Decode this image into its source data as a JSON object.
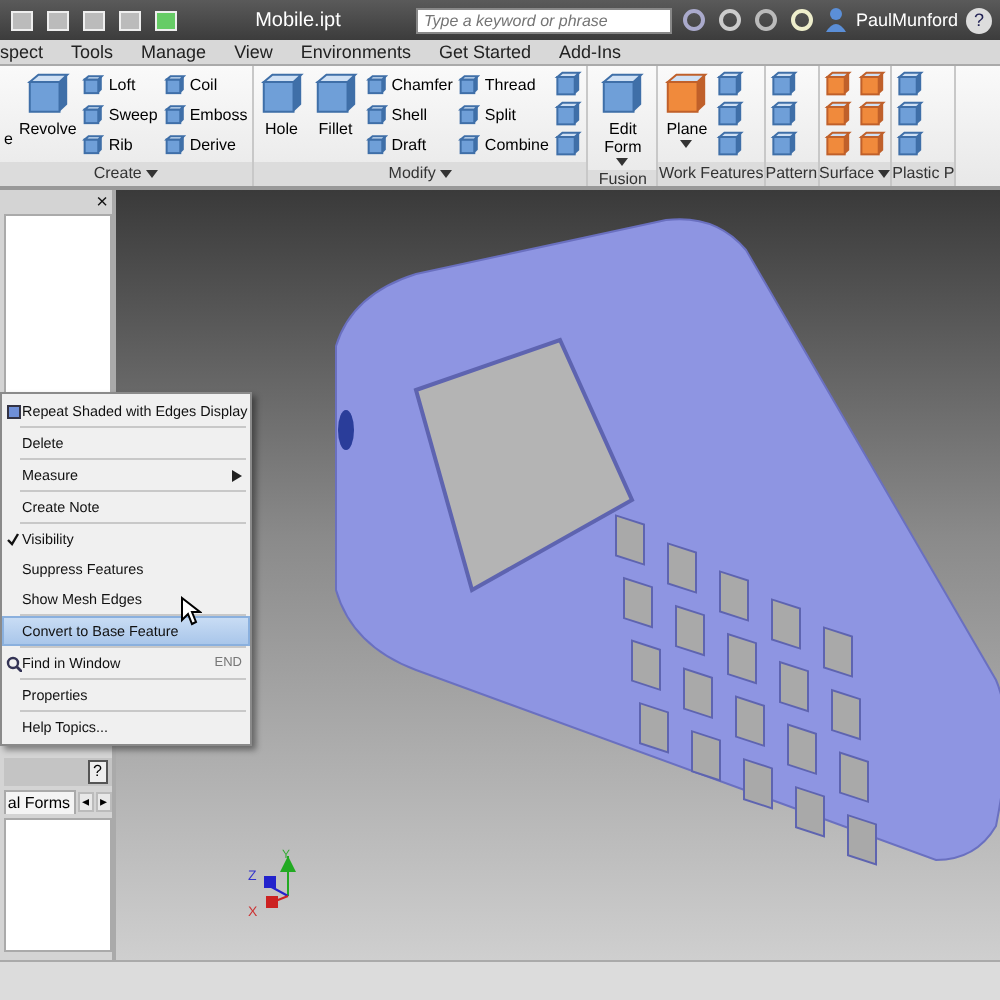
{
  "titlebar": {
    "title": "Mobile.ipt",
    "search": {
      "placeholder": "Type a keyword or phrase"
    },
    "user": "PaulMunford",
    "help": "?"
  },
  "menu_tabs": [
    "spect",
    "Tools",
    "Manage",
    "View",
    "Environments",
    "Get Started",
    "Add-Ins"
  ],
  "ribbon": [
    {
      "title": "Create",
      "dropdown": true,
      "columns": [
        [
          {
            "kind": "cut",
            "label": "e"
          }
        ],
        [
          {
            "kind": "large",
            "label": "Revolve",
            "dropdown": false
          }
        ],
        [
          {
            "kind": "small",
            "label": "Loft"
          },
          {
            "kind": "small",
            "label": "Sweep"
          },
          {
            "kind": "small",
            "label": "Rib"
          }
        ],
        [
          {
            "kind": "small",
            "label": "Coil"
          },
          {
            "kind": "small",
            "label": "Emboss"
          },
          {
            "kind": "small",
            "label": "Derive"
          }
        ]
      ]
    },
    {
      "title": "Modify",
      "dropdown": true,
      "columns": [
        [
          {
            "kind": "large",
            "label": "Hole",
            "dropdown": false
          }
        ],
        [
          {
            "kind": "large",
            "label": "Fillet",
            "dropdown": false
          }
        ],
        [
          {
            "kind": "small",
            "label": "Chamfer"
          },
          {
            "kind": "small",
            "label": "Shell"
          },
          {
            "kind": "small",
            "label": "Draft"
          }
        ],
        [
          {
            "kind": "small",
            "label": "Thread"
          },
          {
            "kind": "small",
            "label": "Split"
          },
          {
            "kind": "small",
            "label": "Combine"
          }
        ],
        [
          {
            "kind": "icon"
          },
          {
            "kind": "icon"
          },
          {
            "kind": "icon"
          }
        ]
      ]
    },
    {
      "title": "Fusion",
      "dropdown": false,
      "columns": [
        [
          {
            "kind": "large",
            "label": "Edit Form",
            "dropdown": true
          }
        ]
      ]
    },
    {
      "title": "Work Features",
      "dropdown": false,
      "columns": [
        [
          {
            "kind": "large",
            "label": "Plane",
            "dropdown": true
          }
        ],
        [
          {
            "kind": "icon"
          },
          {
            "kind": "icon"
          },
          {
            "kind": "icon"
          }
        ]
      ]
    },
    {
      "title": "Pattern",
      "dropdown": false,
      "columns": [
        [
          {
            "kind": "icon"
          },
          {
            "kind": "icon"
          },
          {
            "kind": "icon"
          }
        ]
      ]
    },
    {
      "title": "Surface",
      "dropdown": true,
      "columns": [
        [
          {
            "kind": "icon"
          },
          {
            "kind": "icon"
          },
          {
            "kind": "icon"
          }
        ],
        [
          {
            "kind": "icon"
          },
          {
            "kind": "icon"
          },
          {
            "kind": "icon"
          }
        ]
      ]
    },
    {
      "title": "Plastic P",
      "dropdown": false,
      "columns": [
        [
          {
            "kind": "icon"
          },
          {
            "kind": "icon"
          },
          {
            "kind": "icon"
          }
        ]
      ]
    }
  ],
  "left_panels": [
    {
      "close": "×"
    },
    {
      "help": "?",
      "tab": "al Forms",
      "arrows": [
        "◂",
        "▸"
      ]
    }
  ],
  "context_menu": {
    "groups": [
      [
        {
          "label": "Repeat Shaded with Edges Display",
          "checked": false,
          "selected": false,
          "submenu": false
        }
      ],
      [
        {
          "label": "Delete",
          "checked": false,
          "selected": false,
          "submenu": false
        }
      ],
      [
        {
          "label": "Measure",
          "checked": false,
          "selected": false,
          "submenu": true
        }
      ],
      [
        {
          "label": "Create Note",
          "checked": false,
          "selected": false,
          "submenu": false
        }
      ],
      [
        {
          "label": "Visibility",
          "checked": true,
          "selected": false,
          "submenu": false
        },
        {
          "label": "Suppress Features",
          "checked": false,
          "selected": false,
          "submenu": false
        },
        {
          "label": "Show Mesh Edges",
          "checked": false,
          "selected": false,
          "submenu": false
        }
      ],
      [
        {
          "label": "Convert to Base Feature",
          "checked": false,
          "selected": true,
          "submenu": false
        }
      ],
      [
        {
          "label": "Find in Window",
          "shortcut": "END",
          "checked": false,
          "selected": false,
          "submenu": false
        }
      ],
      [
        {
          "label": "Properties",
          "checked": false,
          "selected": false,
          "submenu": false
        }
      ],
      [
        {
          "label": "Help Topics...",
          "checked": false,
          "selected": false,
          "submenu": false
        }
      ]
    ]
  },
  "axes": [
    "X",
    "Y",
    "Z"
  ]
}
